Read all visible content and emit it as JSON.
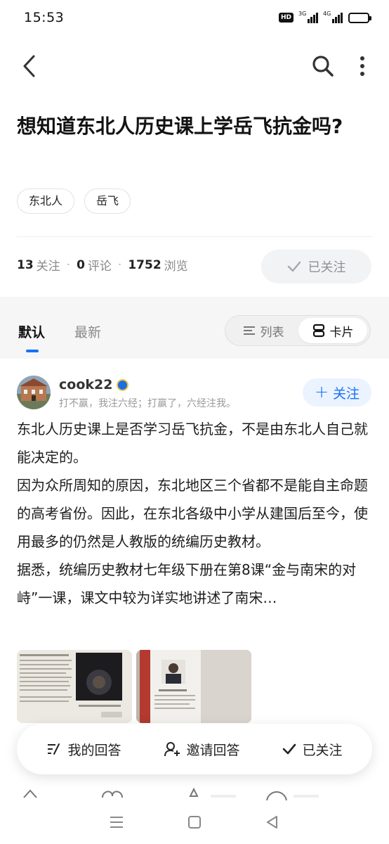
{
  "status_bar": {
    "time": "15:53",
    "hd_label": "HD",
    "sim1_label": "3G",
    "sim2_label": "4G"
  },
  "nav": {
    "back_icon": "chevron-left-icon",
    "search_icon": "search-icon",
    "more_icon": "more-vertical-icon"
  },
  "question": {
    "title": "想知道东北人历史课上学岳飞抗金吗?",
    "tags": [
      "东北人",
      "岳飞"
    ],
    "follow_count": "13",
    "follow_label": "关注",
    "comment_count": "0",
    "comment_label": "评论",
    "view_count": "1752",
    "view_label": "浏览",
    "followed_button": "已关注"
  },
  "sort": {
    "default_tab": "默认",
    "latest_tab": "最新",
    "list_label": "列表",
    "card_label": "卡片"
  },
  "answer": {
    "author": "cook22",
    "bio": "打不赢，我注六经；打赢了，六经注我。",
    "follow_button": "关注",
    "paragraphs": [
      "东北人历史课上是否学习岳飞抗金，不是由东北人自己就能决定的。",
      "因为众所周知的原因，东北地区三个省都不是能自主命题的高考省份。因此，在东北各级中小学从建国后至今，使用最多的仍然是人教版的统编历史教材。",
      "据悉，统编历史教材七年级下册在第8课“金与南宋的对峙”一课，课文中较为详实地讲述了南宋…"
    ]
  },
  "action_bar": {
    "my_answer": "我的回答",
    "invite": "邀请回答",
    "followed": "已关注"
  },
  "colors": {
    "accent": "#1772f6",
    "follow_bg": "#ebf3ff",
    "muted": "#8a8a8a"
  }
}
